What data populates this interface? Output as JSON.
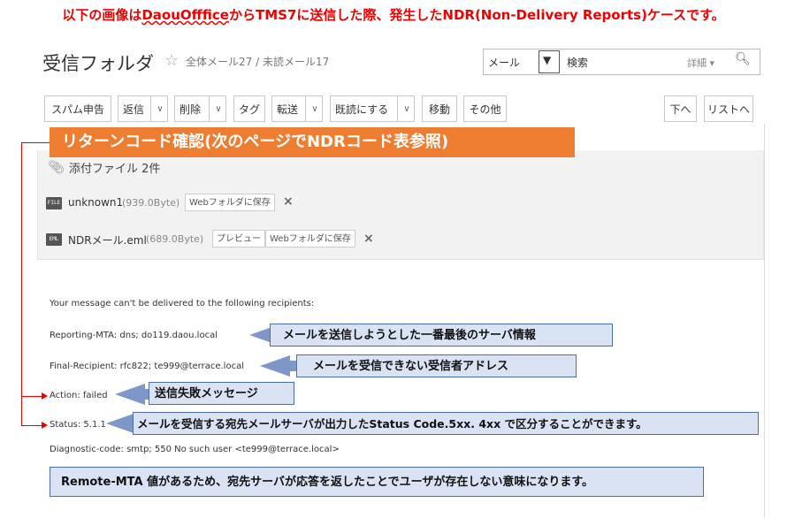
{
  "top_note": {
    "prefix": "以下の画像は",
    "underlined": "DaouOfffice",
    "suffix": "からTMS7に送信した際、発生したNDR(Non-Delivery Reports)ケースです。"
  },
  "header": {
    "title": "受信フォルダ",
    "counts": "全体メール27 / 未読メール17"
  },
  "search": {
    "select_value": "メール",
    "keyword": "検索",
    "detail_label": "詳細 ▾"
  },
  "toolbar": {
    "spam": "スパム申告",
    "reply": "返信",
    "delete": "削除",
    "tag": "タグ",
    "forward": "転送",
    "mark_read": "既読にする",
    "move": "移動",
    "other": "その他",
    "next": "下へ",
    "list": "リストへ",
    "dropdown_glyph": "∨"
  },
  "banner_text": "リターンコード確認(次のページでNDRコード表参照)",
  "attachments": {
    "title": "添付ファイル 2件",
    "files": [
      {
        "icon": "FILE",
        "name": "unknown1",
        "size": "(939.0Byte)",
        "btn_preview": "",
        "btn_save": "Webフォルダに保存"
      },
      {
        "icon": "EML",
        "name": "NDRメール.eml",
        "size": "(689.0Byte)",
        "btn_preview": "プレビュー",
        "btn_save": "Webフォルダに保存"
      }
    ],
    "close_glyph": "×"
  },
  "message": {
    "intro": "Your message can't be delivered to the following recipients:",
    "reporting_mta": "Reporting-MTA: dns; do119.daou.local",
    "final_recipient": "Final-Recipient: rfc822; te999@terrace.local",
    "action": "Action: failed",
    "status": "Status: 5.1.1",
    "diagnostic": "Diagnostic-code: smtp; 550 No such user <te999@terrace.local>"
  },
  "callouts": {
    "reporting_mta": "メールを送信しようとした一番最後のサーバ情報",
    "final_recipient": "メールを受信できない受信者アドレス",
    "action": "送信失敗メッセージ",
    "status": "メールを受信する宛先メールサーバが出力したStatus Code.5xx. 4xx で区分することができます。",
    "bottom": "Remote-MTA 値があるため、宛先サーバが応答を返したことでユーザが存在しない意味になります。"
  },
  "colors": {
    "red_note": "#ee0000",
    "banner": "#ed7d31",
    "callout_fill": "#dae3f3",
    "callout_border": "#4a6fa5",
    "arrow": "#7f96c8"
  }
}
